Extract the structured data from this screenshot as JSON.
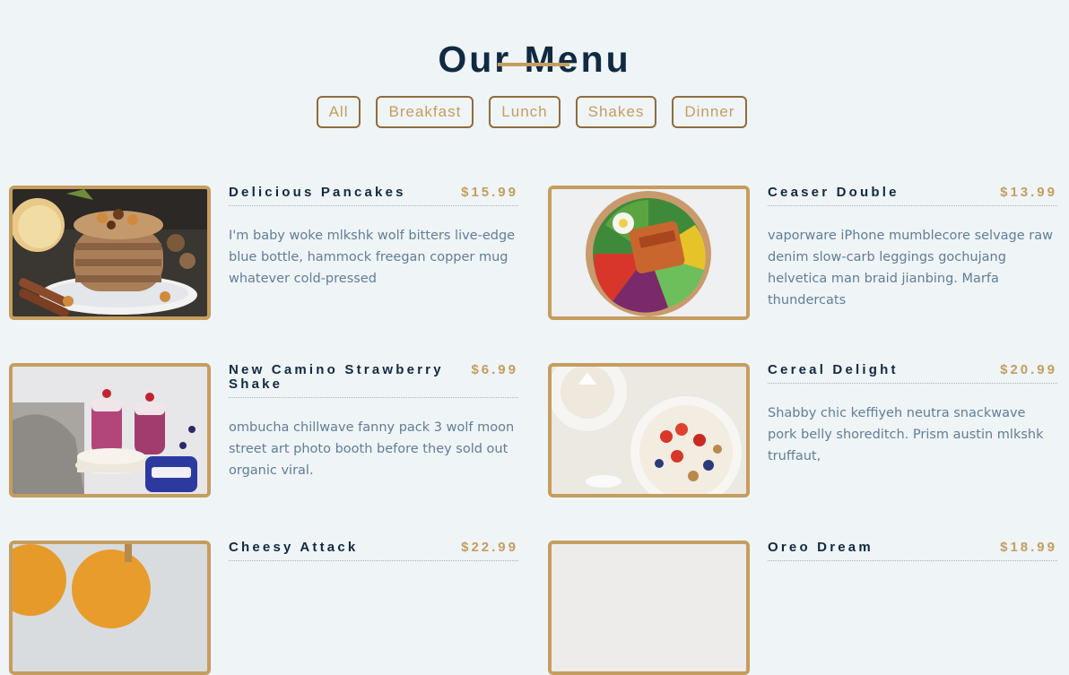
{
  "page": {
    "title": "Our Menu"
  },
  "filters": [
    "All",
    "Breakfast",
    "Lunch",
    "Shakes",
    "Dinner"
  ],
  "menu": [
    {
      "name": "Delicious Pancakes",
      "price": "$15.99",
      "description": "I'm baby woke mlkshk wolf bitters live-edge blue bottle, hammock freegan copper mug whatever cold-pressed",
      "image": "pancakes-photo"
    },
    {
      "name": "Ceaser Double",
      "price": "$13.99",
      "description": "vaporware iPhone mumblecore selvage raw denim slow-carb leggings gochujang helvetica man braid jianbing. Marfa thundercats",
      "image": "salad-bowl-photo"
    },
    {
      "name": "New Camino Strawberry Shake",
      "price": "$6.99",
      "description": "ombucha chillwave fanny pack 3 wolf moon street art photo booth before they sold out organic viral.",
      "image": "berry-shake-photo"
    },
    {
      "name": "Cereal Delight",
      "price": "$20.99",
      "description": "Shabby chic keffiyeh neutra snackwave pork belly shoreditch. Prism austin mlkshk truffaut,",
      "image": "cereal-bowl-photo"
    },
    {
      "name": "Cheesy Attack",
      "price": "$22.99",
      "description": "",
      "image": "burger-photo"
    },
    {
      "name": "Oreo Dream",
      "price": "$18.99",
      "description": "",
      "image": "oreo-shake-photo"
    }
  ],
  "colors": {
    "background": "#eff4f6",
    "heading": "#102a43",
    "accent": "#c59d5f",
    "text": "#617d98"
  }
}
